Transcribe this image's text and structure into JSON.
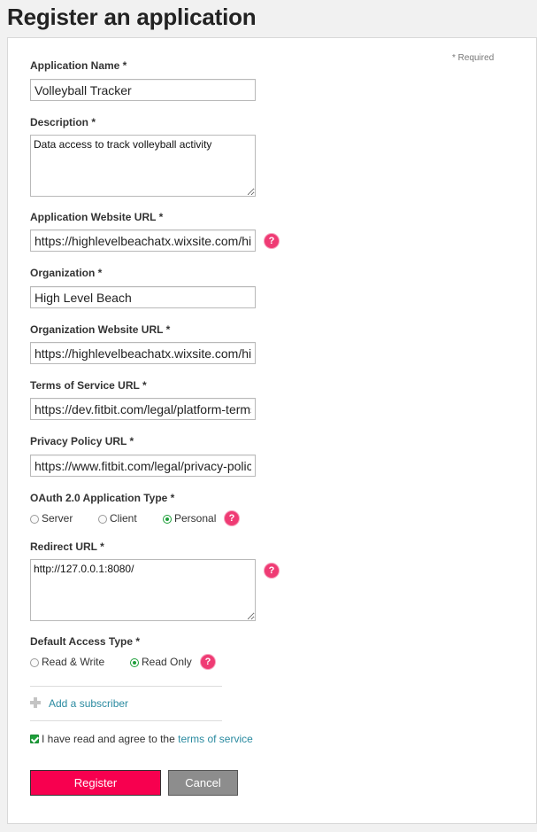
{
  "page": {
    "title": "Register an application"
  },
  "form": {
    "required_note": "* Required",
    "app_name": {
      "label": "Application Name *",
      "value": "Volleyball Tracker"
    },
    "description": {
      "label": "Description *",
      "value": "Data access to track volleyball activity"
    },
    "app_website": {
      "label": "Application Website URL *",
      "value": "https://highlevelbeachatx.wixsite.com/high-level-beach"
    },
    "organization": {
      "label": "Organization *",
      "value": "High Level Beach"
    },
    "org_website": {
      "label": "Organization Website URL *",
      "value": "https://highlevelbeachatx.wixsite.com/high-level-beach"
    },
    "tos_url": {
      "label": "Terms of Service URL *",
      "value": "https://dev.fitbit.com/legal/platform-terms-of-service/"
    },
    "privacy_url": {
      "label": "Privacy Policy URL *",
      "value": "https://www.fitbit.com/legal/privacy-policy"
    },
    "oauth_type": {
      "label": "OAuth 2.0 Application Type *",
      "options": [
        "Server",
        "Client",
        "Personal"
      ],
      "selected": "Personal"
    },
    "redirect_url": {
      "label": "Redirect URL *",
      "value": "http://127.0.0.1:8080/"
    },
    "access_type": {
      "label": "Default Access Type *",
      "options": [
        "Read & Write",
        "Read Only"
      ],
      "selected": "Read Only"
    },
    "add_subscriber": "Add a subscriber",
    "agree_text": "I have read and agree to the",
    "agree_link": "terms of service",
    "agree_checked": true,
    "help_glyph": "?",
    "register_label": "Register",
    "cancel_label": "Cancel"
  },
  "colors": {
    "accent": "#f7004f",
    "help": "#ef3b74",
    "link": "#2a8aa0",
    "check": "#1e9f3a",
    "cancel": "#8d8d8d"
  },
  "icons": [
    "help-icon",
    "plus-icon",
    "checkbox-checked-icon",
    "radio-selected-icon",
    "textarea-resize-handle"
  ]
}
